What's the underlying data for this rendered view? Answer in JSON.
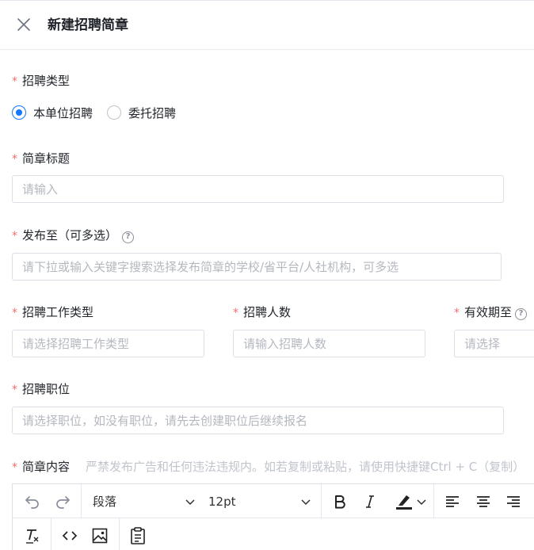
{
  "header": {
    "title": "新建招聘简章"
  },
  "form": {
    "required_mark": "*",
    "recruit_type": {
      "label": "招聘类型",
      "options": [
        "本单位招聘",
        "委托招聘"
      ],
      "selected": "本单位招聘"
    },
    "brief_title": {
      "label": "简章标题",
      "placeholder": "请输入",
      "value": ""
    },
    "publish_to": {
      "label": "发布至（可多选）",
      "help": "?",
      "placeholder": "请下拉或输入关键字搜索选择发布简章的学校/省平台/人社机构，可多选"
    },
    "job_type": {
      "label": "招聘工作类型",
      "placeholder": "请选择招聘工作类型"
    },
    "headcount": {
      "label": "招聘人数",
      "placeholder": "请输入招聘人数"
    },
    "valid_until": {
      "label": "有效期至",
      "help": "?",
      "placeholder": "请选择"
    },
    "position": {
      "label": "招聘职位",
      "placeholder": "请选择职位，如没有职位，请先去创建职位后继续报名"
    },
    "content": {
      "label": "简章内容",
      "hint": "严禁发布广告和任何违法违规内。如若复制或粘贴，请使用快捷键Ctrl + C（复制）"
    }
  },
  "editor_toolbar": {
    "block_format": "段落",
    "font_size": "12pt",
    "icons": [
      "undo-icon",
      "redo-icon",
      "bold-icon",
      "italic-icon",
      "highlight-icon",
      "align-left-icon",
      "align-center-icon",
      "align-right-icon",
      "clear-format-icon",
      "code-icon",
      "image-icon",
      "paste-icon"
    ]
  },
  "colors": {
    "accent": "#1677ff",
    "required": "#f56c6c",
    "border": "#dcdfe6",
    "placeholder": "#b4b8bf"
  }
}
